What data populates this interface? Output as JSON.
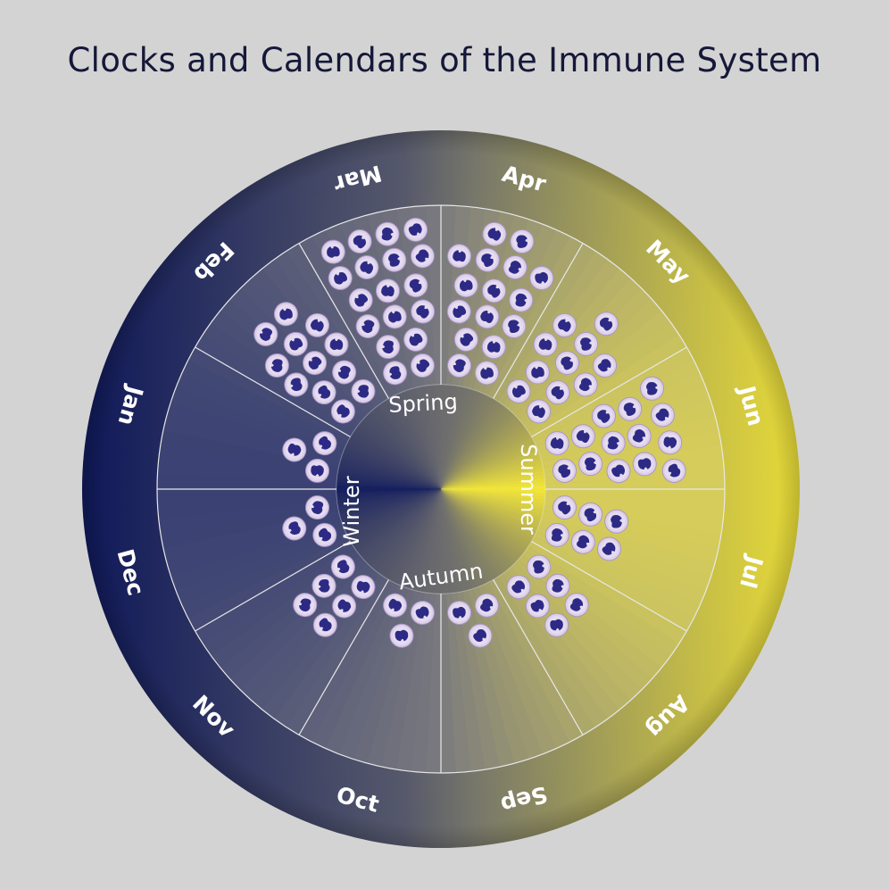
{
  "title": "Clocks and Calendars of the Immune System",
  "colors": {
    "background": "#d3d3d3",
    "title": "#151838",
    "winter": "#101a5e",
    "summer": "#f3e63a",
    "cell_membrane": "#ddd0ea",
    "cell_nucleus": "#2d2a86",
    "divider": "#e8e8e8"
  },
  "months": [
    {
      "label": "Jan",
      "cells": 3
    },
    {
      "label": "Feb",
      "cells": 12
    },
    {
      "label": "Mar",
      "cells": 24
    },
    {
      "label": "Apr",
      "cells": 16
    },
    {
      "label": "May",
      "cells": 11
    },
    {
      "label": "Jun",
      "cells": 14
    },
    {
      "label": "Jul",
      "cells": 6
    },
    {
      "label": "Aug",
      "cells": 6
    },
    {
      "label": "Sep",
      "cells": 3
    },
    {
      "label": "Oct",
      "cells": 3
    },
    {
      "label": "Nov",
      "cells": 6
    },
    {
      "label": "Dec",
      "cells": 3
    }
  ],
  "seasons": [
    "Spring",
    "Summer",
    "Autumn",
    "Winter"
  ],
  "cell_icon": "neutrophil-cell-icon"
}
